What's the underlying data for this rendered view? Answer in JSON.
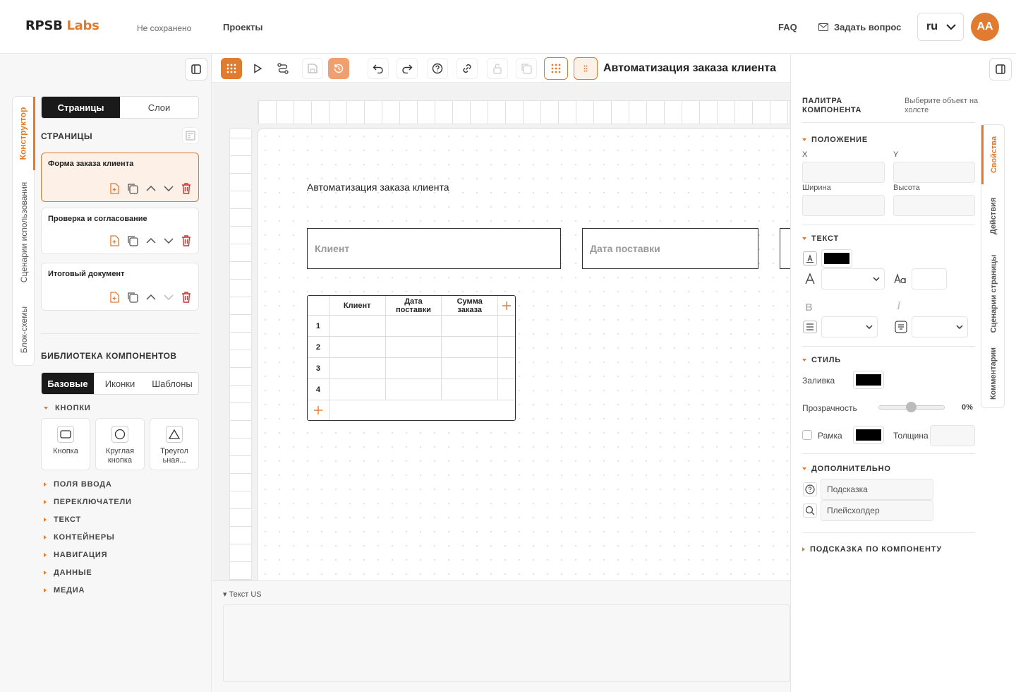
{
  "header": {
    "logo_main": "RPSB",
    "logo_accent": "Labs",
    "save_status": "Не сохранено",
    "projects": "Проекты",
    "faq": "FAQ",
    "ask": "Задать вопрос",
    "language": "ru",
    "avatar": "AA"
  },
  "left": {
    "vtabs": [
      "Конструктор",
      "Сценарии использования",
      "Блок-схемы"
    ],
    "tabs": [
      "Страницы",
      "Слои"
    ],
    "pages_title": "СТРАНИЦЫ",
    "pages": [
      "Форма заказа клиента",
      "Проверка и согласование",
      "Итоговый документ"
    ],
    "library_title": "БИБЛИОТЕКА КОМПОНЕНТОВ",
    "lib_tabs": [
      "Базовые",
      "Иконки",
      "Шаблоны"
    ],
    "buttons_cat": "КНОПКИ",
    "components": [
      "Кнопка",
      "Круглая кнопка",
      "Треугол ьная..."
    ],
    "categories": [
      "ПОЛЯ ВВОДА",
      "ПЕРЕКЛЮЧАТЕЛИ",
      "ТЕКСТ",
      "КОНТЕЙНЕРЫ",
      "НАВИГАЦИЯ",
      "ДАННЫЕ",
      "МЕДИА"
    ]
  },
  "toolbar": {
    "title": "Автоматизация заказа клиента"
  },
  "canvas": {
    "heading": "Автоматизация заказа клиента",
    "input1": "Клиент",
    "input2": "Дата поставки",
    "table_headers": [
      "Клиент",
      "Дата поставки",
      "Сумма заказа"
    ],
    "table_rows": [
      "1",
      "2",
      "3",
      "4"
    ]
  },
  "bottom": {
    "label": "Текст US"
  },
  "right": {
    "palette_title": "ПАЛИТРА КОМПОНЕНТА",
    "palette_hint": "Выберите объект на холсте",
    "position": "ПОЛОЖЕНИЕ",
    "x": "X",
    "y": "Y",
    "width": "Ширина",
    "height": "Высота",
    "text": "ТЕКСТ",
    "style": "СТИЛЬ",
    "fill": "Заливка",
    "opacity": "Прозрачность",
    "opacity_value": "0%",
    "border": "Рамка",
    "thickness": "Толщина",
    "extra": "ДОПОЛНИТЕЛЬНО",
    "tooltip": "Подсказка",
    "placeholder": "Плейсхолдер",
    "component_hint": "ПОДСКАЗКА ПО КОМПОНЕНТУ",
    "vtabs": [
      "Свойства",
      "Действия",
      "Сценарии страницы",
      "Комментарии"
    ],
    "fill_color": "#000000",
    "text_color": "#000000",
    "border_color": "#000000"
  },
  "colors": {
    "accent": "#e07b2f"
  }
}
